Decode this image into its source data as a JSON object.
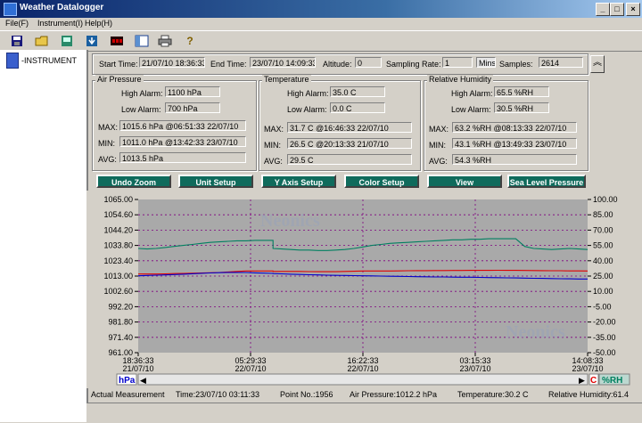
{
  "window": {
    "title": "Weather Datalogger",
    "min_label": "_",
    "max_label": "□",
    "close_label": "×"
  },
  "menu": {
    "items": [
      "File(F)",
      "Instrument(I)",
      "Help(H)"
    ]
  },
  "tree": {
    "root_label": "-INSTRUMENT"
  },
  "info": {
    "start_time_label": "Start Time:",
    "start_time": "21/07/10 18:36:33",
    "end_time_label": "End Time:",
    "end_time": "23/07/10 14:09:33",
    "altitude_label": "Altitude:",
    "altitude": "0",
    "sampling_rate_label": "Sampling Rate:",
    "sampling_rate": "1",
    "sampling_unit": "Mins",
    "samples_label": "Samples:",
    "samples": "2614"
  },
  "air_pressure": {
    "title": "Air Pressure",
    "high_alarm_label": "High Alarm:",
    "high_alarm": "1100 hPa",
    "low_alarm_label": "Low Alarm:",
    "low_alarm": "700 hPa",
    "max_label": "MAX:",
    "max": "1015.6 hPa @06:51:33 22/07/10",
    "min_label": "MIN:",
    "min": "1011.0 hPa @13:42:33 23/07/10",
    "avg_label": "AVG:",
    "avg": "1013.5 hPa"
  },
  "temperature": {
    "title": "Temperature",
    "high_alarm_label": "High Alarm:",
    "high_alarm": "35.0 C",
    "low_alarm_label": "Low Alarm:",
    "low_alarm": "0.0 C",
    "max_label": "MAX:",
    "max": "31.7 C @16:46:33 22/07/10",
    "min_label": "MIN:",
    "min": "26.5 C @20:13:33 21/07/10",
    "avg_label": "AVG:",
    "avg": "29.5 C"
  },
  "humidity": {
    "title": "Relative Humidity",
    "high_alarm_label": "High Alarm:",
    "high_alarm": "65.5 %RH",
    "low_alarm_label": "Low Alarm:",
    "low_alarm": "30.5 %RH",
    "max_label": "MAX:",
    "max": "63.2 %RH @08:13:33 22/07/10",
    "min_label": "MIN:",
    "min": "43.1 %RH @13:49:33 23/07/10",
    "avg_label": "AVG:",
    "avg": "54.3 %RH"
  },
  "buttons": {
    "undo_zoom": "Undo Zoom",
    "unit_setup": "Unit Setup",
    "y_axis_setup": "Y Axis Setup",
    "color_setup": "Color Setup",
    "view": "View",
    "sea_level": "Sea Level Pressure"
  },
  "watermark": "Neonics",
  "axis_tags": {
    "left": "hPa",
    "right_c": "C",
    "right_rh": "%RH"
  },
  "colors": {
    "plot_bg": "#a9a9a9",
    "grid": "#800080",
    "humidity": "#008060",
    "temperature": "#e00000",
    "pressure": "#0000cc",
    "button": "#0f6b5c"
  },
  "status": {
    "actual_label": "Actual Measurement",
    "time": "Time:23/07/10 03:11:33",
    "point": "Point No.:1956",
    "pressure": "Air Pressure:1012.2 hPa",
    "temperature": "Temperature:30.2 C",
    "humidity": "Relative Humidity:61.4"
  },
  "chart_data": {
    "type": "line",
    "left_axis": {
      "label": "hPa",
      "ylim": [
        961,
        1065
      ],
      "ticks": [
        "1065.00",
        "1054.60",
        "1044.20",
        "1033.80",
        "1023.40",
        "1013.00",
        "1002.60",
        "992.20",
        "981.80",
        "971.40",
        "961.00"
      ]
    },
    "right_axis": {
      "ylim": [
        -50,
        100
      ],
      "ticks": [
        "100.00",
        "85.00",
        "70.00",
        "55.00",
        "40.00",
        "25.00",
        "10.00",
        "-5.00",
        "-20.00",
        "-35.00",
        "-50.00"
      ]
    },
    "x_ticks": [
      {
        "time": "18:36:33",
        "date": "21/07/10"
      },
      {
        "time": "05:29:33",
        "date": "22/07/10"
      },
      {
        "time": "16:22:33",
        "date": "22/07/10"
      },
      {
        "time": "03:15:33",
        "date": "23/07/10"
      },
      {
        "time": "14:08:33",
        "date": "23/07/10"
      }
    ],
    "x": [
      0,
      0.02,
      0.04,
      0.06,
      0.08,
      0.1,
      0.12,
      0.14,
      0.16,
      0.18,
      0.2,
      0.22,
      0.24,
      0.26,
      0.28,
      0.3,
      0.3,
      0.32,
      0.34,
      0.36,
      0.38,
      0.4,
      0.42,
      0.44,
      0.46,
      0.48,
      0.5,
      0.52,
      0.54,
      0.56,
      0.58,
      0.6,
      0.62,
      0.64,
      0.66,
      0.68,
      0.7,
      0.72,
      0.74,
      0.76,
      0.78,
      0.8,
      0.82,
      0.84,
      0.86,
      0.88,
      0.9,
      0.92,
      0.94,
      0.96,
      0.98,
      1.0
    ],
    "series": [
      {
        "name": "%RH",
        "axis": "right",
        "values": [
          52,
          51.5,
          52,
          53,
          54,
          55,
          56,
          57,
          58,
          58.5,
          59,
          59.5,
          59.5,
          60,
          60,
          60,
          52,
          51.5,
          51,
          50.5,
          50.5,
          50,
          50,
          50.5,
          51,
          52,
          53.5,
          55,
          56,
          57,
          57.5,
          58,
          58.5,
          59,
          59.5,
          60,
          60.5,
          60.5,
          61,
          61,
          61.5,
          61.5,
          61.5,
          61.5,
          54,
          52,
          51.5,
          51,
          51.5,
          52,
          51.5,
          51
        ]
      },
      {
        "name": "C",
        "axis": "right",
        "values": [
          27,
          27,
          27,
          27.2,
          27.4,
          27.6,
          27.8,
          28,
          28.2,
          28.5,
          29,
          29.5,
          30,
          30,
          30,
          30,
          29.5,
          29.5,
          29.5,
          29.5,
          29.4,
          29.3,
          29.3,
          29.3,
          29.5,
          29.7,
          30,
          30,
          30,
          30,
          30.1,
          30.2,
          30.3,
          30.3,
          30.4,
          30.4,
          30.5,
          30.5,
          30.6,
          30.6,
          30.6,
          30.7,
          30.6,
          30.6,
          30.5,
          30.4,
          30.3,
          30.2,
          30.2,
          30.1,
          30.1,
          30.0
        ]
      },
      {
        "name": "hPa",
        "axis": "left",
        "values": [
          1013.2,
          1013.4,
          1013.6,
          1013.8,
          1014.0,
          1014.3,
          1014.6,
          1014.9,
          1015.1,
          1015.3,
          1015.5,
          1015.5,
          1015.4,
          1015.2,
          1015.0,
          1014.8,
          1014.7,
          1014.5,
          1014.3,
          1014.1,
          1013.9,
          1013.8,
          1013.6,
          1013.5,
          1013.4,
          1013.3,
          1013.2,
          1013.1,
          1013.0,
          1012.9,
          1012.8,
          1012.7,
          1012.6,
          1012.5,
          1012.4,
          1012.4,
          1012.3,
          1012.2,
          1012.2,
          1012.1,
          1012.0,
          1011.9,
          1011.8,
          1011.7,
          1011.6,
          1011.5,
          1011.4,
          1011.3,
          1011.2,
          1011.1,
          1011.0,
          1011.0
        ]
      }
    ]
  }
}
